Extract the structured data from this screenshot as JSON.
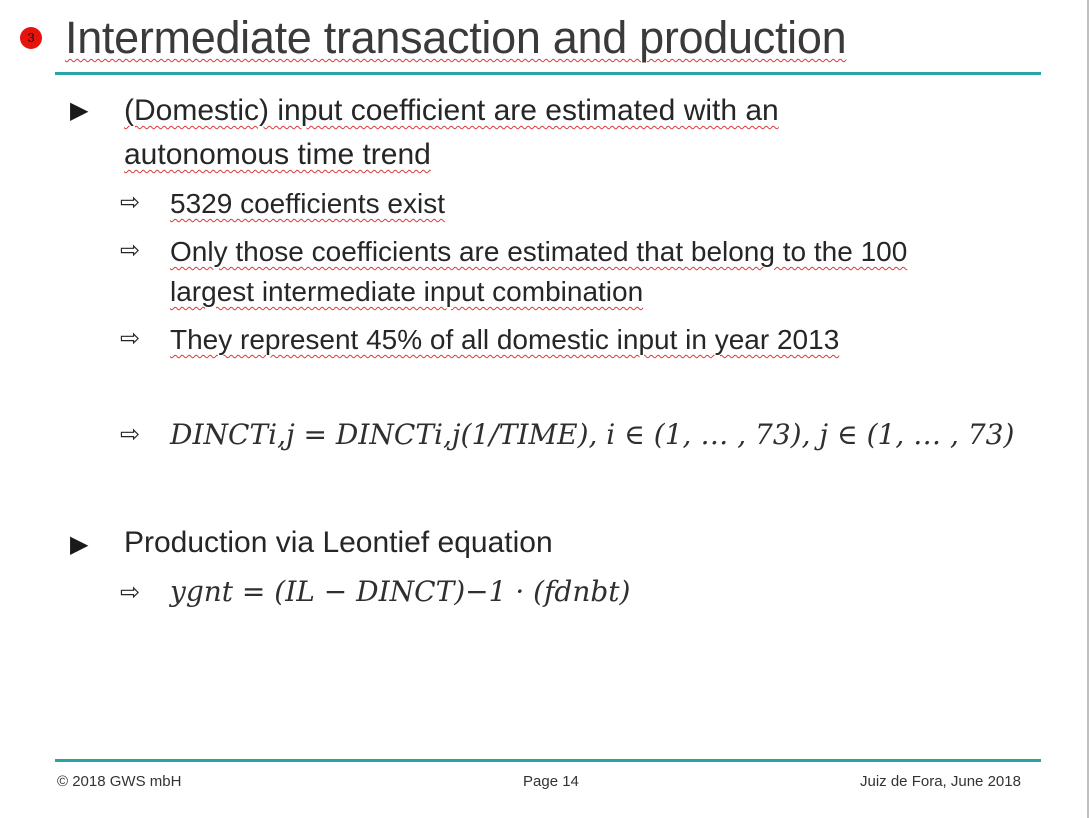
{
  "slide": {
    "badge": "3",
    "title": "Intermediate transaction and production",
    "bullet1": {
      "line1": "(Domestic) input coefficient are estimated with an",
      "line2": "autonomous time trend",
      "subs": [
        "5329 coefficients exist",
        "Only those coefficients are estimated that belong to the 100",
        "largest intermediate input combination",
        "They represent 45% of all domestic input in year 2013"
      ],
      "formula": "DINCTi,j = DINCTi,j(1/TIME), i ∈ (1, … , 73), j ∈ (1, … , 73)"
    },
    "bullet2": {
      "text": "Production via Leontief equation",
      "formula": "ygnt = (IL − DINCT)−1 · (fdnbt)"
    },
    "icons": {
      "main_bullet": "▶",
      "sub_bullet": "⇨"
    },
    "footer": {
      "left": "© 2018 GWS mbH",
      "center": "Page 14",
      "right": "Juiz de Fora, June 2018"
    },
    "colors": {
      "rule": "#2aa3a6",
      "badge": "#e8120c"
    }
  }
}
